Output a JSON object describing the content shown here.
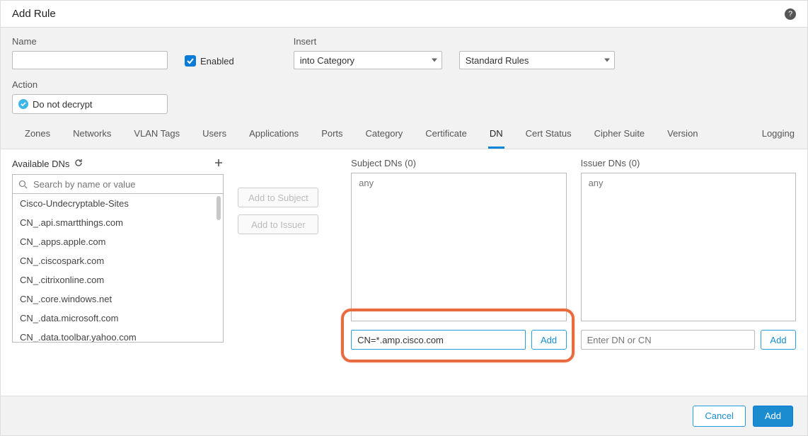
{
  "title": "Add Rule",
  "help_tooltip": "?",
  "labels": {
    "name": "Name",
    "enabled": "Enabled",
    "insert": "Insert",
    "action": "Action"
  },
  "insert_select": "into Category",
  "group_select": "Standard Rules",
  "action_select": "Do not decrypt",
  "tabs": {
    "zones": "Zones",
    "networks": "Networks",
    "vlan": "VLAN Tags",
    "users": "Users",
    "applications": "Applications",
    "ports": "Ports",
    "category": "Category",
    "certificate": "Certificate",
    "dn": "DN",
    "cert_status": "Cert Status",
    "cipher_suite": "Cipher Suite",
    "version": "Version",
    "logging": "Logging"
  },
  "available": {
    "label": "Available DNs",
    "search_placeholder": "Search by name or value",
    "items": [
      "Cisco-Undecryptable-Sites",
      "CN_.api.smartthings.com",
      "CN_.apps.apple.com",
      "CN_.ciscospark.com",
      "CN_.citrixonline.com",
      "CN_.core.windows.net",
      "CN_.data.microsoft.com",
      "CN_.data.toolbar.yahoo.com"
    ]
  },
  "mid_buttons": {
    "add_subject": "Add to Subject",
    "add_issuer": "Add to Issuer"
  },
  "subject": {
    "label": "Subject DNs (0)",
    "any": "any",
    "input_value": "CN=*.amp.cisco.com",
    "add": "Add"
  },
  "issuer": {
    "label": "Issuer DNs (0)",
    "any": "any",
    "input_placeholder": "Enter DN or CN",
    "add": "Add"
  },
  "footer": {
    "cancel": "Cancel",
    "add": "Add"
  }
}
